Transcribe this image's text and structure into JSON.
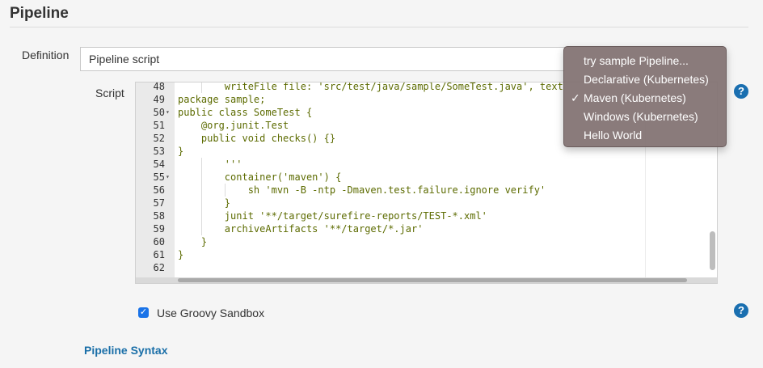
{
  "section": {
    "title": "Pipeline"
  },
  "definition": {
    "label": "Definition",
    "value": "Pipeline script"
  },
  "script": {
    "label": "Script",
    "lines": [
      {
        "num": "48",
        "text": "        writeFile file: 'src/test/java/sample/SomeTest.java', text",
        "fold": false,
        "indent": 1
      },
      {
        "num": "49",
        "text": "package sample;",
        "fold": false,
        "indent": 0
      },
      {
        "num": "50",
        "text": "public class SomeTest {",
        "fold": true,
        "indent": 0
      },
      {
        "num": "51",
        "text": "    @org.junit.Test",
        "fold": false,
        "indent": 0
      },
      {
        "num": "52",
        "text": "    public void checks() {}",
        "fold": false,
        "indent": 0
      },
      {
        "num": "53",
        "text": "}",
        "fold": false,
        "indent": 0
      },
      {
        "num": "54",
        "text": "        '''",
        "fold": false,
        "indent": 1
      },
      {
        "num": "55",
        "text": "        container('maven') {",
        "fold": true,
        "indent": 1
      },
      {
        "num": "56",
        "text": "            sh 'mvn -B -ntp -Dmaven.test.failure.ignore verify'",
        "fold": false,
        "indent": 2
      },
      {
        "num": "57",
        "text": "        }",
        "fold": false,
        "indent": 1
      },
      {
        "num": "58",
        "text": "        junit '**/target/surefire-reports/TEST-*.xml'",
        "fold": false,
        "indent": 1
      },
      {
        "num": "59",
        "text": "        archiveArtifacts '**/target/*.jar'",
        "fold": false,
        "indent": 1
      },
      {
        "num": "60",
        "text": "    }",
        "fold": false,
        "indent": 0
      },
      {
        "num": "61",
        "text": "}",
        "fold": false,
        "indent": 0
      },
      {
        "num": "62",
        "text": "",
        "fold": false,
        "indent": 0
      }
    ]
  },
  "sample_menu": {
    "items": [
      {
        "label": "try sample Pipeline...",
        "checked": false
      },
      {
        "label": "Declarative (Kubernetes)",
        "checked": false
      },
      {
        "label": "Maven (Kubernetes)",
        "checked": true
      },
      {
        "label": "Windows (Kubernetes)",
        "checked": false
      },
      {
        "label": "Hello World",
        "checked": false
      }
    ]
  },
  "sandbox": {
    "label": "Use Groovy Sandbox",
    "checked": true
  },
  "links": {
    "syntax": "Pipeline Syntax"
  },
  "help": {
    "glyph": "?"
  },
  "icons": {
    "check": "✓"
  },
  "colors": {
    "accent": "#1a6fb0",
    "code": "#5c6b00",
    "menu_bg": "#807070"
  }
}
